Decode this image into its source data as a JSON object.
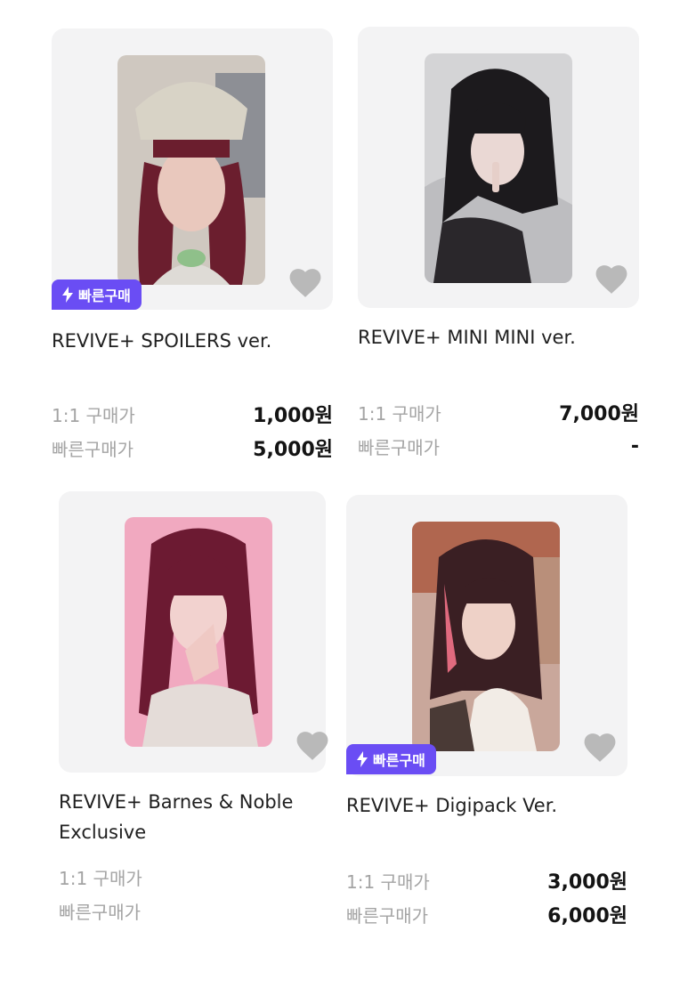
{
  "products": [
    {
      "title": "REVIVE+ SPOILERS ver.",
      "badge": "빠른구매",
      "prices": [
        {
          "label": "1:1 구매가",
          "value": "1,000원"
        },
        {
          "label": "빠른구매가",
          "value": "5,000원"
        }
      ]
    },
    {
      "title": "REVIVE+ MINI MINI ver.",
      "prices": [
        {
          "label": "1:1 구매가",
          "value": "7,000원"
        },
        {
          "label": "빠른구매가",
          "value": "-"
        }
      ]
    },
    {
      "title_lines": [
        "REVIVE+ Barnes & Noble",
        "Exclusive"
      ],
      "prices": [
        {
          "label": "1:1 구매가",
          "value": ""
        },
        {
          "label": "빠른구매가",
          "value": ""
        }
      ]
    },
    {
      "title": "REVIVE+ Digipack Ver.",
      "badge": "빠른구매",
      "prices": [
        {
          "label": "1:1 구매가",
          "value": "3,000원"
        },
        {
          "label": "빠른구매가",
          "value": "6,000원"
        }
      ]
    }
  ],
  "colors": {
    "badge": "#6a4df4",
    "tile": "#f3f3f4",
    "heart": "#b9b9b9"
  }
}
